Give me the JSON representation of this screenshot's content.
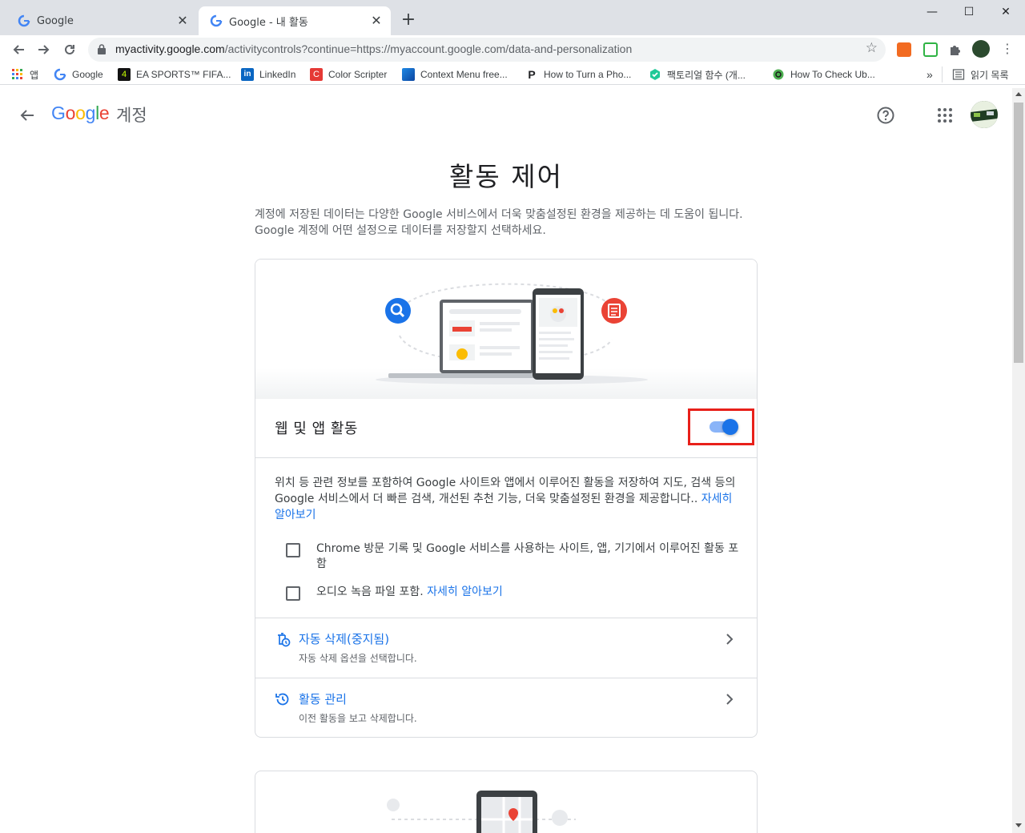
{
  "browser": {
    "tabs": [
      {
        "title": "Google",
        "close": "✕"
      },
      {
        "title": "Google - 내 활동",
        "close": "✕"
      }
    ],
    "new_tab": "+",
    "window_controls": {
      "minimize": "—",
      "maximize": "☐",
      "close": "✕"
    },
    "url": {
      "host": "myactivity.google.com",
      "path": "/activitycontrols?continue=https://myaccount.google.com/data-and-personalization"
    },
    "bookmarks": [
      {
        "label": "앱",
        "icon": "apps-grid-icon"
      },
      {
        "label": "Google",
        "icon": "google-icon"
      },
      {
        "label": "EA SPORTS™ FIFA...",
        "icon": "fifa-icon"
      },
      {
        "label": "LinkedIn",
        "icon": "linkedin-icon"
      },
      {
        "label": "Color Scripter",
        "icon": "color-scripter-icon"
      },
      {
        "label": "Context Menu free...",
        "icon": "context-menu-icon"
      },
      {
        "label": "How to Turn a Pho...",
        "icon": "p-icon"
      },
      {
        "label": "팩토리얼 함수 (개...",
        "icon": "factorial-icon"
      },
      {
        "label": "How To Check Ub...",
        "icon": "ubuntu-icon"
      }
    ],
    "bookmarks_overflow": "»",
    "reading_list": "읽기 목록"
  },
  "header": {
    "logo_text": "Google",
    "product": "계정"
  },
  "main": {
    "title": "활동 제어",
    "intro": "계정에 저장된 데이터는 다양한 Google 서비스에서 더욱 맞춤설정된 환경을 제공하는 데 도움이 됩니다. Google 계정에 어떤 설정으로 데이터를 저장할지 선택하세요.",
    "web_app_activity": {
      "title": "웹 및 앱 활동",
      "toggle_on": true,
      "description": "위치 등 관련 정보를 포함하여 Google 사이트와 앱에서 이루어진 활동을 저장하여 지도, 검색 등의 Google 서비스에서 더 빠른 검색, 개선된 추천 기능, 더욱 맞춤설정된 환경을 제공합니다.. ",
      "learn_more": "자세히 알아보기",
      "checkboxes": [
        {
          "label": "Chrome 방문 기록 및 Google 서비스를 사용하는 사이트, 앱, 기기에서 이루어진 활동 포함",
          "checked": false
        },
        {
          "label": "오디오 녹음 파일 포함. ",
          "link": "자세히 알아보기",
          "checked": false
        }
      ],
      "rows": [
        {
          "title": "자동 삭제(중지됨)",
          "subtitle": "자동 삭제 옵션을 선택합니다.",
          "icon": "auto-delete-icon"
        },
        {
          "title": "활동 관리",
          "subtitle": "이전 활동을 보고 삭제합니다.",
          "icon": "history-icon"
        }
      ]
    }
  },
  "colors": {
    "accent": "#1a73e8",
    "highlight_box": "#e8201a",
    "tab_strip": "#dee1e6"
  }
}
